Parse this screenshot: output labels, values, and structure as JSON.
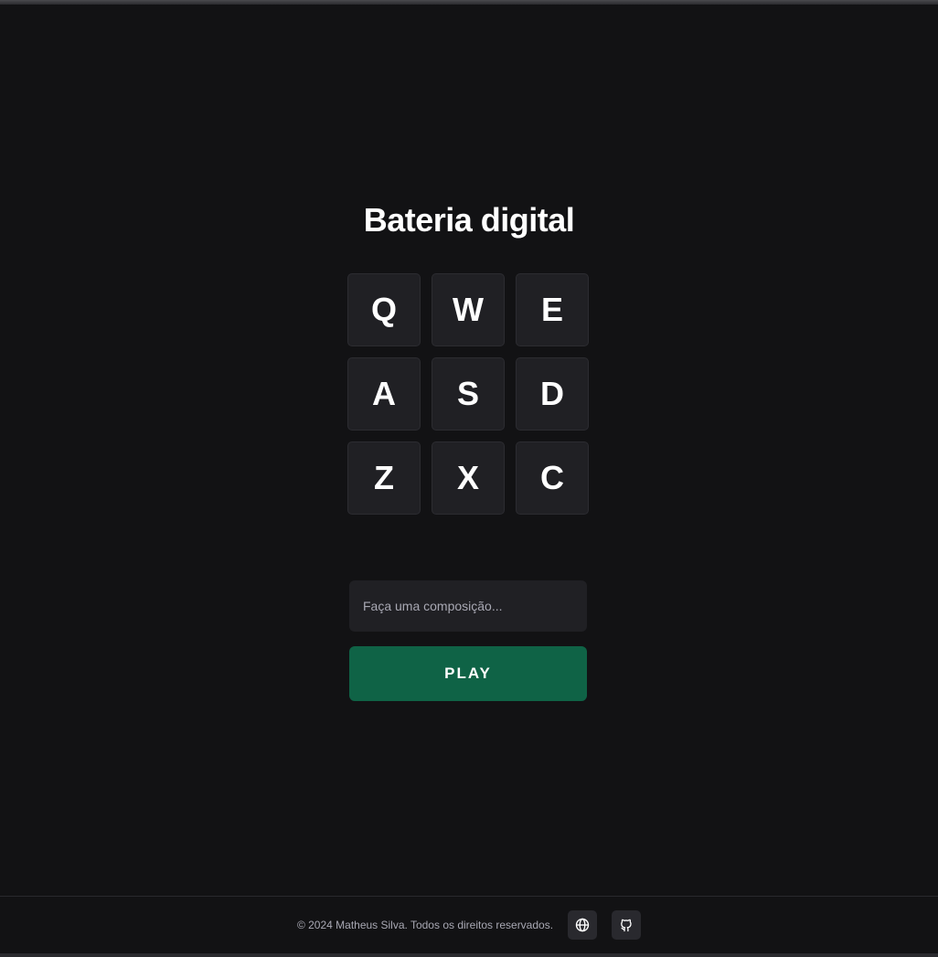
{
  "page": {
    "title": "Bateria digital"
  },
  "pads": [
    {
      "key": "Q"
    },
    {
      "key": "W"
    },
    {
      "key": "E"
    },
    {
      "key": "A"
    },
    {
      "key": "S"
    },
    {
      "key": "D"
    },
    {
      "key": "Z"
    },
    {
      "key": "X"
    },
    {
      "key": "C"
    }
  ],
  "composer": {
    "value": "",
    "placeholder": "Faça uma composição...",
    "play_label": "PLAY"
  },
  "footer": {
    "copyright": "© 2024 Matheus Silva. Todos os direitos reservados.",
    "icons": [
      "globe-icon",
      "github-icon"
    ]
  },
  "colors": {
    "background": "#121214",
    "pad": "#202024",
    "accent": "#0f6346",
    "muted_text": "#a8a8b3"
  }
}
